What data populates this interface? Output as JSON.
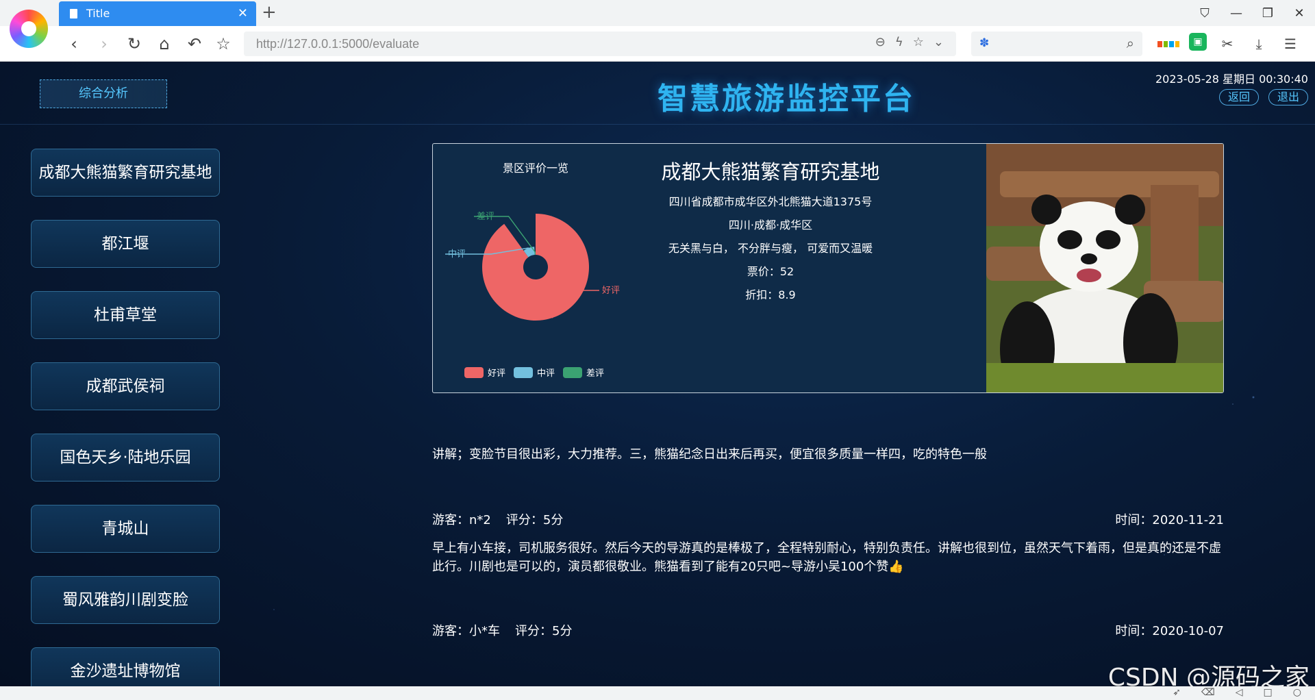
{
  "browser": {
    "tab_title": "Title",
    "url": "http://127.0.0.1:5000/evaluate"
  },
  "header": {
    "analysis_label": "综合分析",
    "title": "智慧旅游监控平台",
    "datetime": "2023-05-28  星期日  00:30:40",
    "back_label": "返回",
    "logout_label": "退出"
  },
  "sidebar": {
    "items": [
      {
        "label": "成都大熊猫繁育研究基地"
      },
      {
        "label": "都江堰"
      },
      {
        "label": "杜甫草堂"
      },
      {
        "label": "成都武侯祠"
      },
      {
        "label": "国色天乡·陆地乐园"
      },
      {
        "label": "青城山"
      },
      {
        "label": "蜀风雅韵川剧变脸"
      },
      {
        "label": "金沙遗址博物馆"
      }
    ]
  },
  "spot": {
    "name": "成都大熊猫繁育研究基地",
    "address": "四川省成都市成华区外北熊猫大道1375号",
    "region": "四川·成都·成华区",
    "slogan": "无关黑与白， 不分胖与瘦， 可爱而又温暖",
    "price": "票价：52",
    "discount": "折扣：8.9"
  },
  "chart_data": {
    "type": "pie",
    "title": "景区评价一览",
    "categories": [
      "好评",
      "中评",
      "差评"
    ],
    "values": [
      90,
      9,
      1
    ],
    "colors": [
      "#ee6666",
      "#73c0de",
      "#3ba272"
    ],
    "legend": "bottom"
  },
  "reviews": {
    "partial_text": "讲解；变脸节目很出彩，大力推荐。三，熊猫纪念日出来后再买，便宜很多质量一样四，吃的特色一般",
    "items": [
      {
        "visitor": "游客：n*2",
        "score": "评分：5分",
        "time": "时间：2020-11-21",
        "text": "早上有小车接，司机服务很好。然后今天的导游真的是棒极了，全程特别耐心，特别负责任。讲解也很到位，虽然天气下着雨，但是真的还是不虚此行。川剧也是可以的，演员都很敬业。熊猫看到了能有20只吧~导游小吴100个赞👍"
      },
      {
        "visitor": "游客：小*车",
        "score": "评分：5分",
        "time": "时间：2020-10-07"
      }
    ]
  },
  "watermark": "CSDN @源码之家",
  "icons": {
    "back": "chevron-left-icon",
    "forward": "chevron-right-icon",
    "reload": "reload-icon",
    "home": "home-icon",
    "star": "star-icon"
  }
}
